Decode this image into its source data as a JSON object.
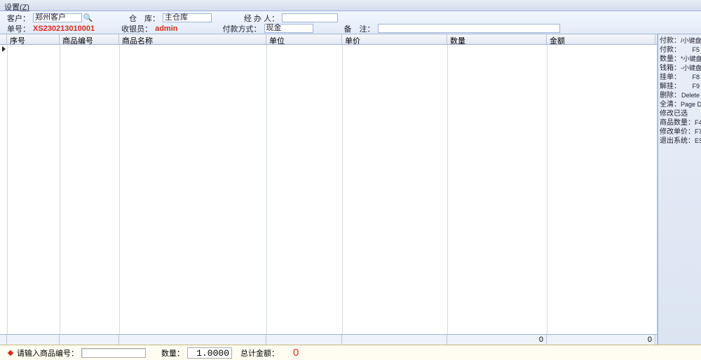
{
  "menu": {
    "settings": "设置",
    "settings_hotkey": "(Z)"
  },
  "top": {
    "customer_lbl": "客户：",
    "customer_val": "郑州客户",
    "warehouse_lbl": "仓　库：",
    "warehouse_val": "主仓库",
    "handler_lbl": "经 办 人：",
    "handler_val": "",
    "orderno_lbl": "单号：",
    "orderno_val": "XS230213010001",
    "cashier_lbl": "收银员：",
    "cashier_val": "admin",
    "paymode_lbl": "付款方式：",
    "paymode_val": "现金",
    "remark_lbl": "备　注：",
    "remark_val": ""
  },
  "columns": [
    "",
    "序号",
    "商品编号",
    "商品名称",
    "单位",
    "单价",
    "数量",
    "金额"
  ],
  "totals": {
    "qty": "0",
    "amount": "0"
  },
  "shortcuts": [
    {
      "k": "付款：",
      "v": "/小键盘"
    },
    {
      "k": "付款：",
      "v": "F5"
    },
    {
      "k": "数量：",
      "v": "*小键盘"
    },
    {
      "k": "钱箱：",
      "v": "-小键盘"
    },
    {
      "k": "挂单：",
      "v": "F8"
    },
    {
      "k": "解挂：",
      "v": "F9"
    },
    {
      "k": "删除：",
      "v": "Delete"
    },
    {
      "k": "全清：",
      "v": "Page Down"
    },
    {
      "k": "修改已选",
      "v": ""
    },
    {
      "k": "商品数量：",
      "v": "F4"
    },
    {
      "k": "修改单价：",
      "v": "F7"
    },
    {
      "k": "退出系统：",
      "v": "ESC"
    }
  ],
  "footer": {
    "prompt": "请输入商品编号：",
    "qty_lbl": "数量：",
    "qty_val": "1.0000",
    "total_lbl": "总计金额：",
    "total_val": "0"
  }
}
